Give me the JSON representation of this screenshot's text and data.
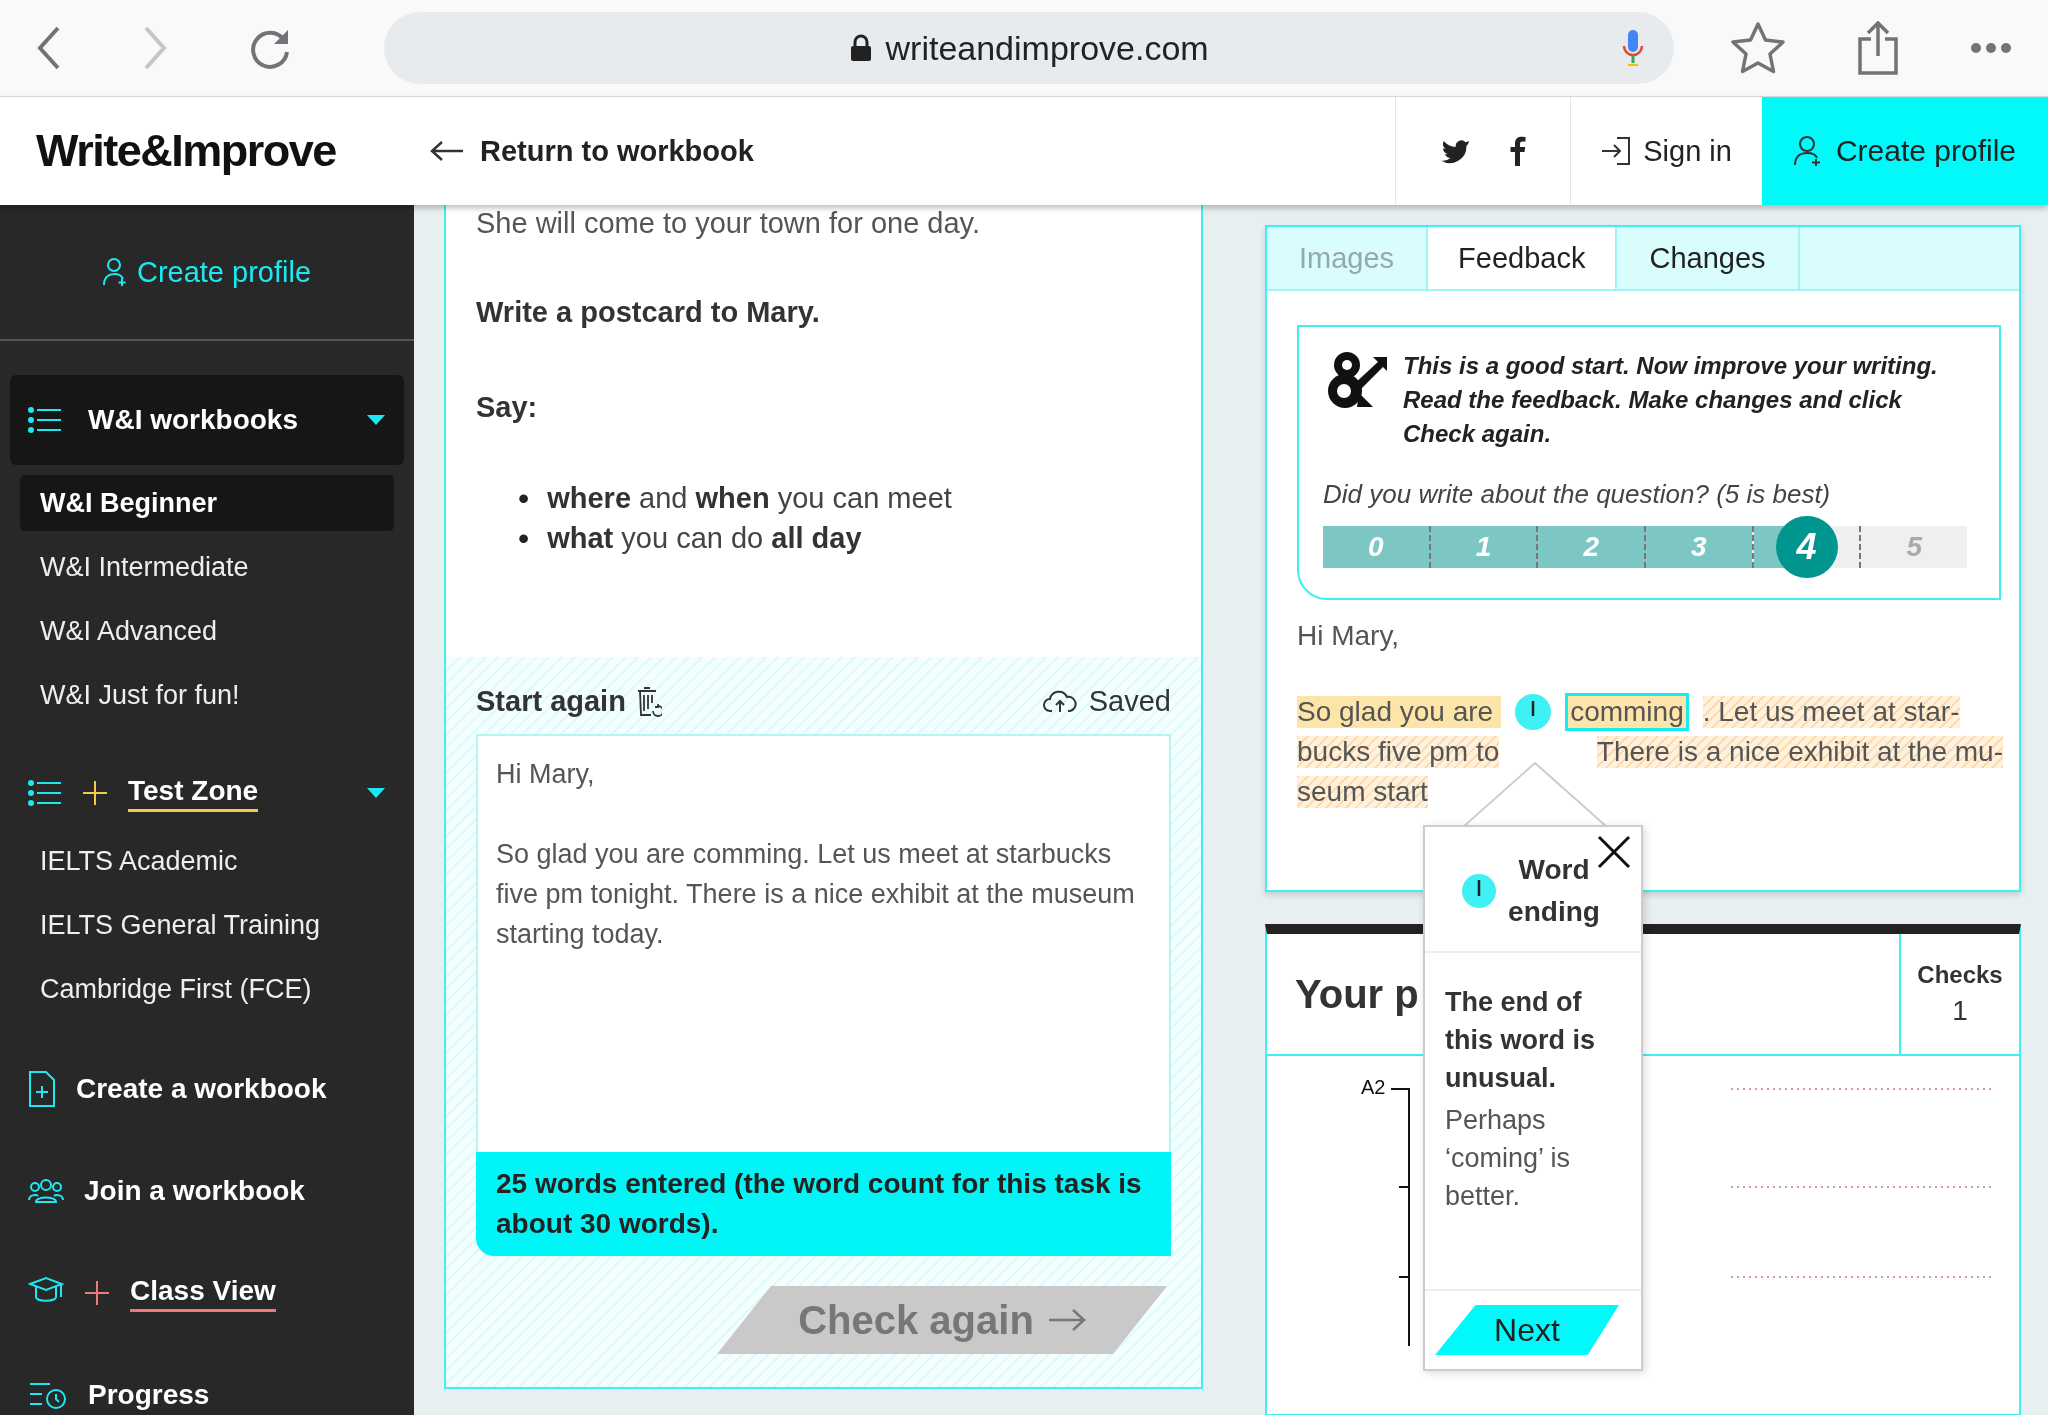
{
  "browser": {
    "url": "writeandimprove.com",
    "back_disabled": false,
    "forward_disabled": true
  },
  "header": {
    "logo": "Write&Improve",
    "return_link": "Return to workbook",
    "sign_in": "Sign in",
    "create_profile": "Create profile"
  },
  "sidebar": {
    "create_profile": "Create profile",
    "sections": [
      {
        "kind": "group",
        "label": "W&I workbooks",
        "expanded": true,
        "children": [
          {
            "label": "W&I Beginner",
            "selected": true
          },
          {
            "label": "W&I Intermediate",
            "selected": false
          },
          {
            "label": "W&I Advanced",
            "selected": false
          },
          {
            "label": "W&I Just for fun!",
            "selected": false
          }
        ]
      },
      {
        "kind": "zone",
        "label": "Test Zone",
        "color": "#f5c94a",
        "expanded": true,
        "children": [
          {
            "label": "IELTS Academic",
            "selected": false
          },
          {
            "label": "IELTS General Training",
            "selected": false
          },
          {
            "label": "Cambridge First (FCE)",
            "selected": false
          }
        ]
      },
      {
        "kind": "link",
        "label": "Create a workbook"
      },
      {
        "kind": "link",
        "label": "Join a workbook"
      },
      {
        "kind": "zone",
        "label": "Class View",
        "color": "#f07a7a"
      },
      {
        "kind": "link",
        "label": "Progress"
      }
    ]
  },
  "task": {
    "intro": "She will come to your town for one day.",
    "instruction": "Write a postcard to Mary.",
    "say": "Say:",
    "bullets": [
      {
        "marker": "•",
        "text": "**where** and **when** you can meet"
      },
      {
        "marker": "•",
        "text": "**what** you can do **all day**"
      }
    ]
  },
  "editor": {
    "start_again": "Start again",
    "saved": "Saved",
    "value": "Hi Mary,\n\nSo glad you are comming. Let us meet at starbucks five pm tonight. There is a nice exhibit at the museum starting today.",
    "word_count": "25 words entered (the word count for this task is about 30 words).",
    "check_button": {
      "label": "Check again",
      "disabled": true
    }
  },
  "tabs": [
    {
      "label": "Images",
      "selected": false,
      "disabled": true
    },
    {
      "label": "Feedback",
      "selected": true,
      "disabled": false
    },
    {
      "label": "Changes",
      "selected": false,
      "disabled": false
    }
  ],
  "feedback": {
    "message": "This is a good start. Now improve your writing. Read the feedback. Make changes and click Check again.",
    "question": "Did you write about the question? (5 is best)",
    "scale": [
      {
        "label": "0",
        "selected": false
      },
      {
        "label": "1",
        "selected": false
      },
      {
        "label": "2",
        "selected": false
      },
      {
        "label": "3",
        "selected": false
      },
      {
        "label": "4",
        "selected": true
      },
      {
        "label": "5",
        "selected": false
      }
    ]
  },
  "annotated_text": {
    "greeting": "Hi Mary,",
    "lines": [
      [
        {
          "kind": "highlight",
          "text": "So glad you are"
        },
        {
          "kind": "marker"
        },
        {
          "kind": "error",
          "text": "comming"
        },
        {
          "kind": "hatched",
          "text": ". Let us meet at star-"
        }
      ],
      [
        {
          "kind": "hatched",
          "text": "bucks five pm to"
        },
        {
          "kind": "hatched",
          "text": "There is a nice exhibit at the mu-"
        }
      ],
      [
        {
          "kind": "hatched",
          "text": "seum start"
        }
      ]
    ]
  },
  "popover": {
    "title": "Word ending",
    "message": "The end of this word is unusual.",
    "hint": "Perhaps ‘coming’ is better.",
    "button": "Next"
  },
  "progress_card": {
    "title": "Your p",
    "checks_label": "Checks",
    "checks_value": "1",
    "axis_label": "A2"
  }
}
